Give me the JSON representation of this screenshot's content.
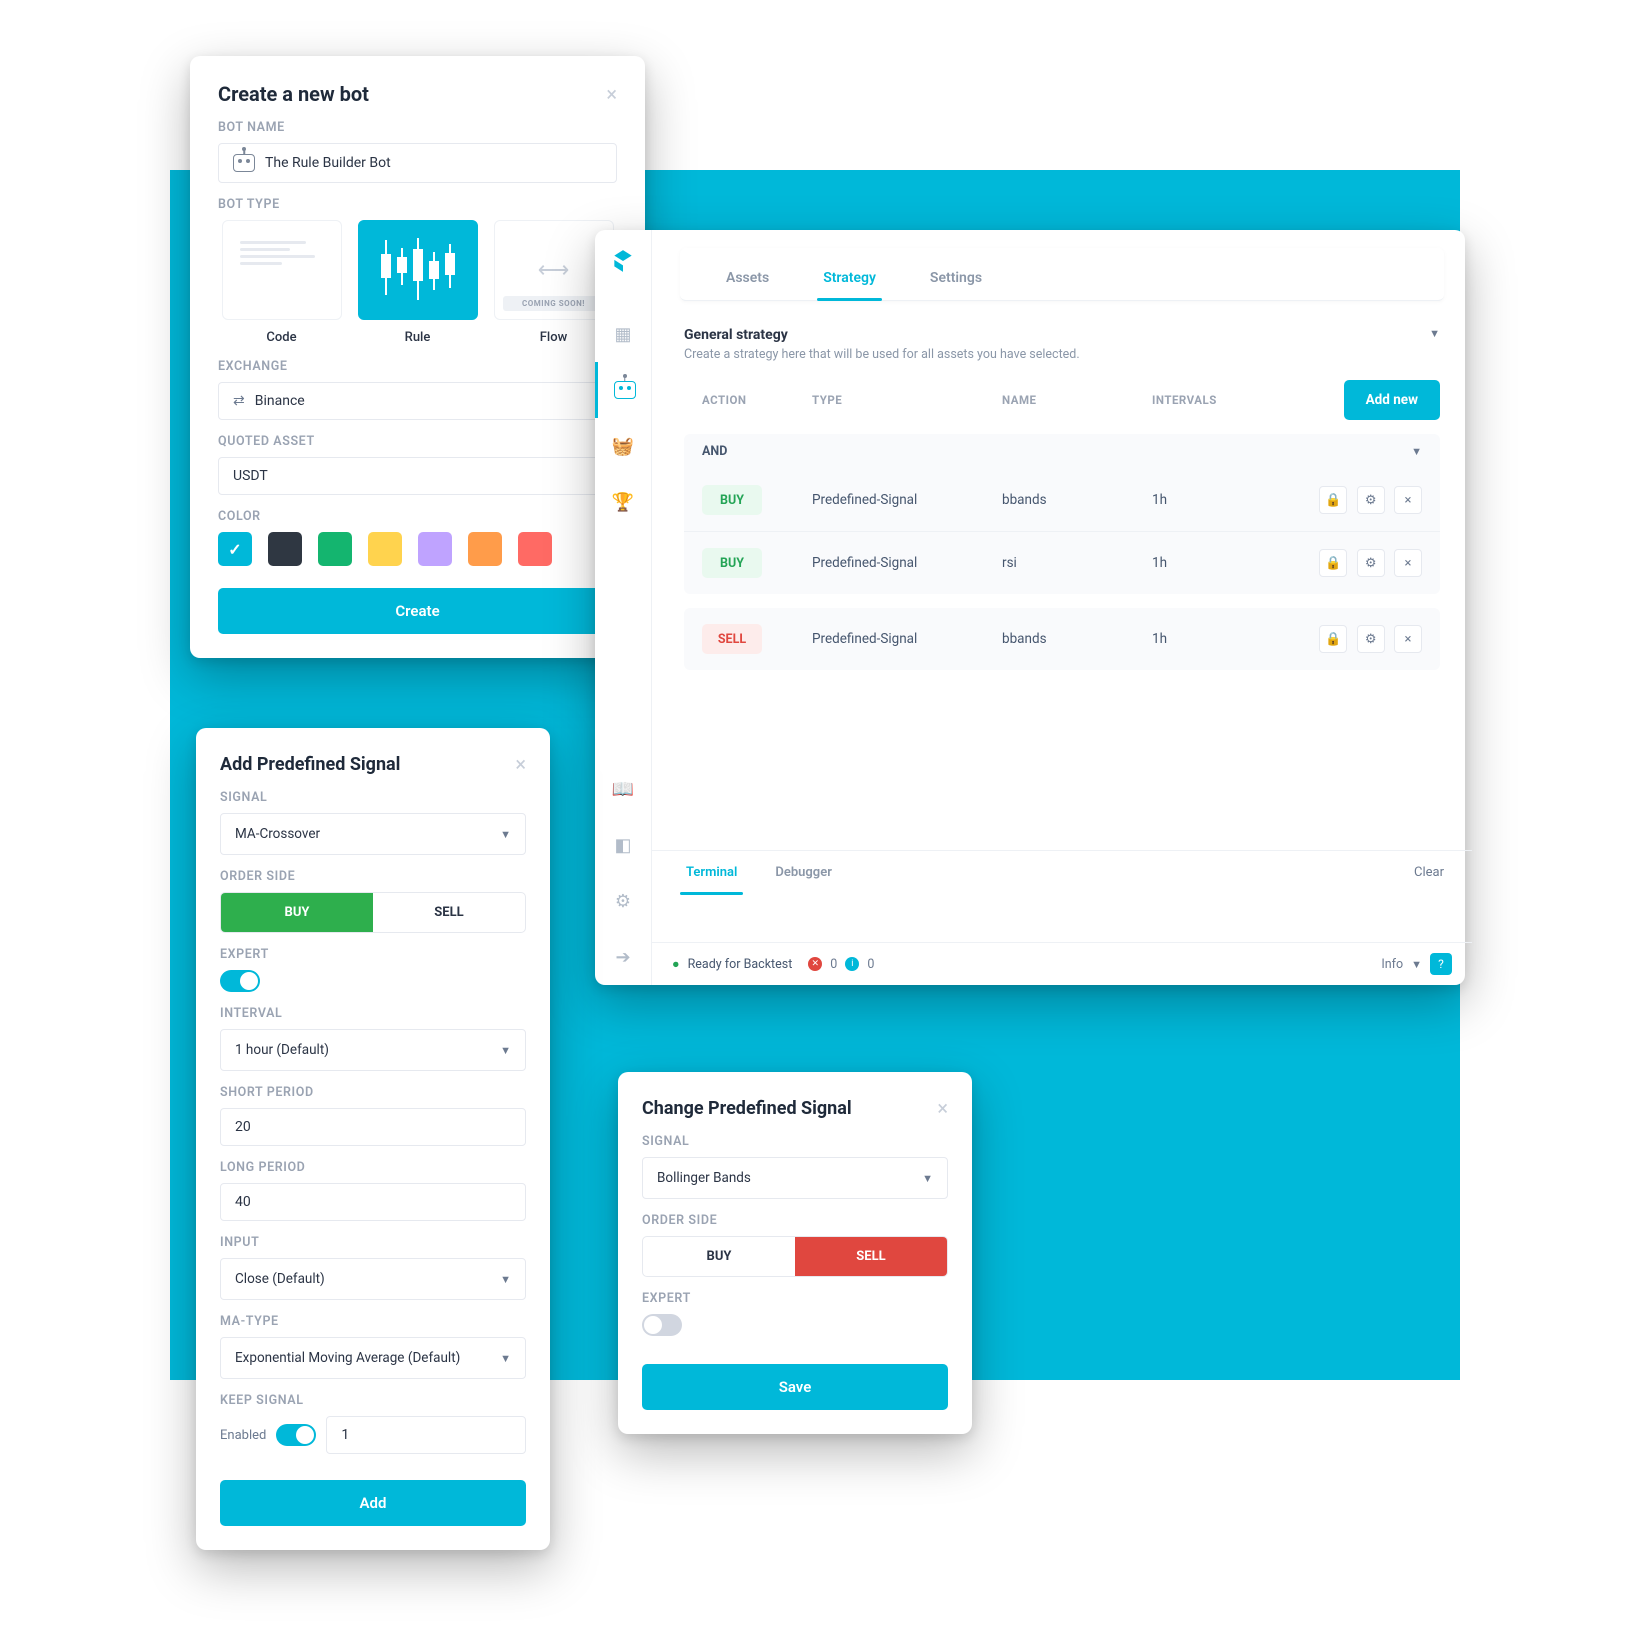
{
  "create": {
    "title": "Create a new bot",
    "name_label": "BOT NAME",
    "name_value": "The Rule Builder Bot",
    "type_label": "BOT TYPE",
    "types": {
      "code": "Code",
      "rule": "Rule",
      "flow": "Flow",
      "coming": "COMING SOON!"
    },
    "exchange_label": "EXCHANGE",
    "exchange_value": "Binance",
    "quoted_label": "QUOTED ASSET",
    "quoted_value": "USDT",
    "color_label": "COLOR",
    "colors": [
      "#00b8d9",
      "#2f3742",
      "#14b56f",
      "#ffd34e",
      "#bfa3ff",
      "#ff9c4a",
      "#ff6a64"
    ],
    "create_btn": "Create"
  },
  "addSignal": {
    "title": "Add Predefined Signal",
    "signal_label": "SIGNAL",
    "signal_value": "MA-Crossover",
    "side_label": "ORDER SIDE",
    "buy": "BUY",
    "sell": "SELL",
    "expert_label": "EXPERT",
    "interval_label": "INTERVAL",
    "interval_value": "1 hour (Default)",
    "short_label": "SHORT PERIOD",
    "short_value": "20",
    "long_label": "LONG PERIOD",
    "long_value": "40",
    "input_label": "INPUT",
    "input_value": "Close (Default)",
    "matype_label": "MA-TYPE",
    "matype_value": "Exponential Moving Average (Default)",
    "keep_label": "KEEP SIGNAL",
    "enabled_label": "Enabled",
    "keep_value": "1",
    "add_btn": "Add"
  },
  "strategy": {
    "tabs": {
      "assets": "Assets",
      "strategy": "Strategy",
      "settings": "Settings"
    },
    "general": {
      "title": "General strategy",
      "desc": "Create a strategy here that will be used for all assets you have selected."
    },
    "headers": {
      "action": "ACTION",
      "type": "TYPE",
      "name": "NAME",
      "intervals": "INTERVALS"
    },
    "add_new": "Add new",
    "and": "AND",
    "rows": [
      {
        "action": "BUY",
        "type": "Predefined-Signal",
        "name": "bbands",
        "interval": "1h"
      },
      {
        "action": "BUY",
        "type": "Predefined-Signal",
        "name": "rsi",
        "interval": "1h"
      },
      {
        "action": "SELL",
        "type": "Predefined-Signal",
        "name": "bbands",
        "interval": "1h"
      }
    ],
    "terminal": "Terminal",
    "debugger": "Debugger",
    "clear": "Clear",
    "ready": "Ready for Backtest",
    "zero1": "0",
    "zero2": "0",
    "info": "Info"
  },
  "change": {
    "title": "Change Predefined Signal",
    "signal_label": "SIGNAL",
    "signal_value": "Bollinger Bands",
    "side_label": "ORDER SIDE",
    "buy": "BUY",
    "sell": "SELL",
    "expert_label": "EXPERT",
    "save_btn": "Save"
  }
}
